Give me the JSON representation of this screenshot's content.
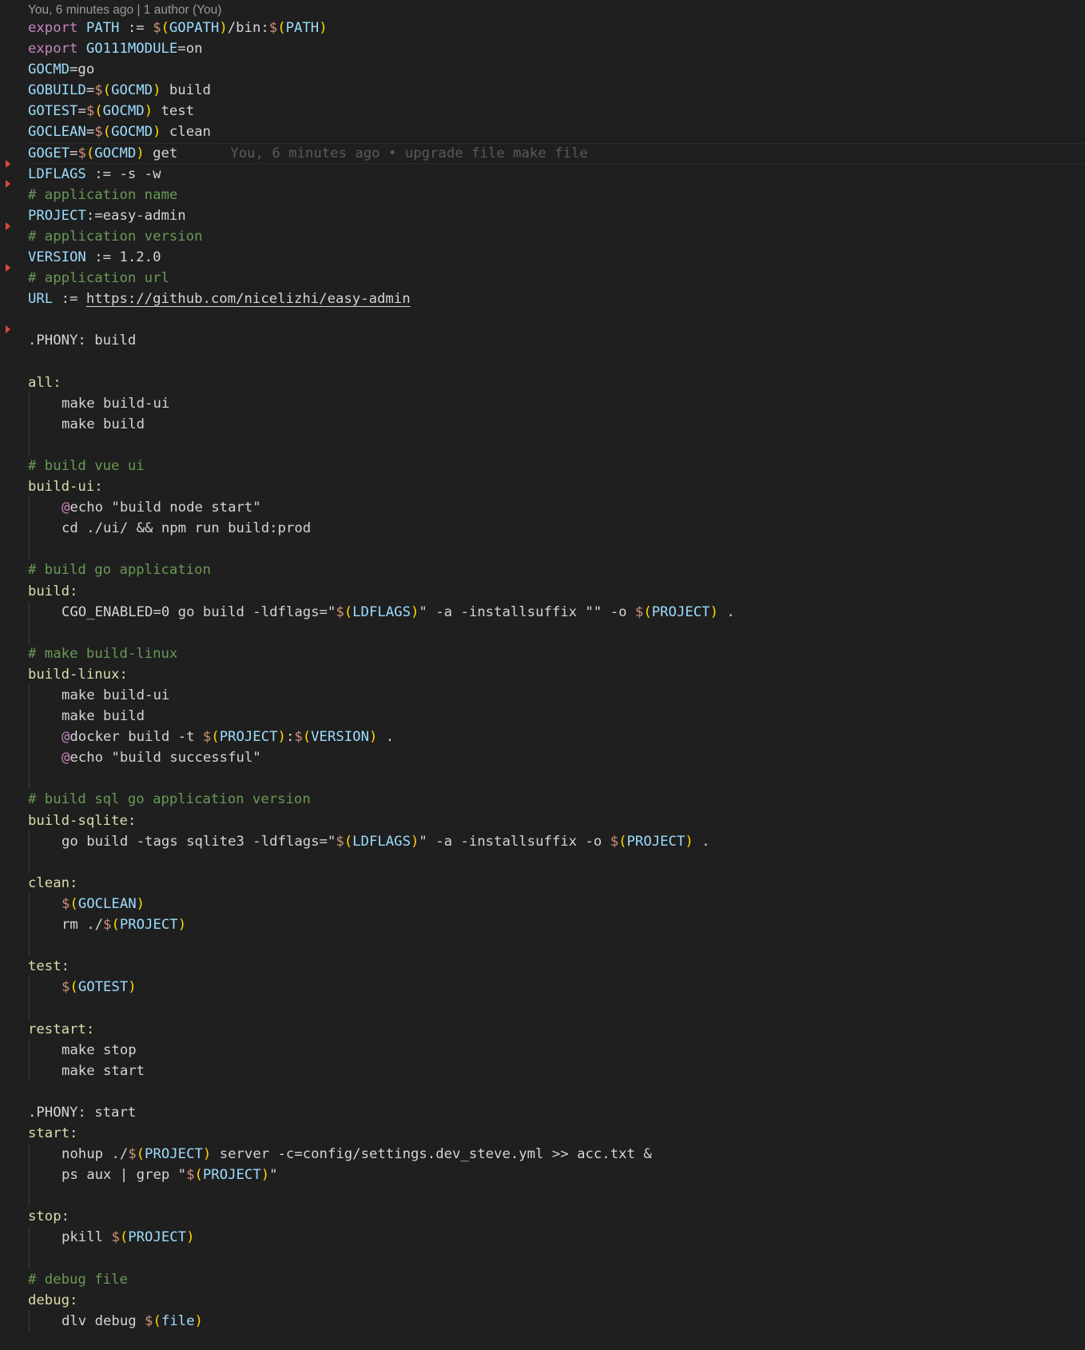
{
  "colors": {
    "background": "#1f1f1f",
    "keyword": "#c586c0",
    "variable": "#9cdcfe",
    "dollar": "#ce9178",
    "paren": "#ffd700",
    "comment": "#6a9955",
    "target": "#dcdcaa"
  },
  "header": {
    "blame": "You, 6 minutes ago | 1 author (You)"
  },
  "inline_blame": "You, 6 minutes ago • upgrade file make file",
  "lines": [
    {
      "t": [
        [
          "export",
          "k"
        ],
        [
          " "
        ],
        [
          "PATH",
          "v"
        ],
        [
          " := "
        ],
        [
          "$",
          "d"
        ],
        [
          "(",
          "p"
        ],
        [
          "GOPATH",
          "v"
        ],
        [
          ")",
          "p"
        ],
        [
          "/bin:"
        ],
        [
          "$",
          "d"
        ],
        [
          "(",
          "p"
        ],
        [
          "PATH",
          "v"
        ],
        [
          ")",
          "p"
        ]
      ]
    },
    {
      "t": [
        [
          "export",
          "k"
        ],
        [
          " "
        ],
        [
          "GO111MODULE",
          "v"
        ],
        [
          "=on"
        ]
      ]
    },
    {
      "t": [
        [
          "GOCMD",
          "v"
        ],
        [
          "=go"
        ]
      ]
    },
    {
      "t": [
        [
          "GOBUILD",
          "v"
        ],
        [
          "="
        ],
        [
          "$",
          "d"
        ],
        [
          "(",
          "p"
        ],
        [
          "GOCMD",
          "v"
        ],
        [
          ")",
          "p"
        ],
        [
          " build"
        ]
      ]
    },
    {
      "t": [
        [
          "GOTEST",
          "v"
        ],
        [
          "="
        ],
        [
          "$",
          "d"
        ],
        [
          "(",
          "p"
        ],
        [
          "GOCMD",
          "v"
        ],
        [
          ")",
          "p"
        ],
        [
          " test"
        ]
      ]
    },
    {
      "t": [
        [
          "GOCLEAN",
          "v"
        ],
        [
          "="
        ],
        [
          "$",
          "d"
        ],
        [
          "(",
          "p"
        ],
        [
          "GOCMD",
          "v"
        ],
        [
          ")",
          "p"
        ],
        [
          " clean"
        ]
      ]
    },
    {
      "cur": true,
      "t": [
        [
          "GOGET",
          "v"
        ],
        [
          "="
        ],
        [
          "$",
          "d"
        ],
        [
          "(",
          "p"
        ],
        [
          "GOCMD",
          "v"
        ],
        [
          ")",
          "p"
        ],
        [
          " get"
        ]
      ]
    },
    {
      "t": [
        [
          "LDFLAGS",
          "v"
        ],
        [
          " := -s -w"
        ]
      ]
    },
    {
      "t": [
        [
          "# application name",
          "c"
        ]
      ]
    },
    {
      "t": [
        [
          "PROJECT",
          "v"
        ],
        [
          ":=easy-admin"
        ]
      ]
    },
    {
      "t": [
        [
          "# application version",
          "c"
        ]
      ]
    },
    {
      "t": [
        [
          "VERSION",
          "v"
        ],
        [
          " := 1.2.0"
        ]
      ]
    },
    {
      "t": [
        [
          "# application url",
          "c"
        ]
      ]
    },
    {
      "t": [
        [
          "URL",
          "v"
        ],
        [
          " := "
        ],
        [
          "https://github.com/nicelizhi/easy-admin",
          "u"
        ]
      ]
    },
    {
      "t": []
    },
    {
      "t": [
        [
          ".PHONY: build"
        ]
      ]
    },
    {
      "t": []
    },
    {
      "t": [
        [
          "all:",
          "t"
        ]
      ]
    },
    {
      "i": true,
      "t": [
        [
          "make build-ui"
        ]
      ]
    },
    {
      "i": true,
      "t": [
        [
          "make build"
        ]
      ]
    },
    {
      "g": true,
      "t": []
    },
    {
      "t": [
        [
          "# build vue ui",
          "c"
        ]
      ]
    },
    {
      "t": [
        [
          "build-ui:",
          "t"
        ]
      ]
    },
    {
      "i": true,
      "t": [
        [
          "@",
          "k"
        ],
        [
          "echo \"build node start\""
        ]
      ]
    },
    {
      "i": true,
      "t": [
        [
          "cd ./ui/ && npm run build:prod"
        ]
      ]
    },
    {
      "g": true,
      "t": []
    },
    {
      "t": [
        [
          "# build go application",
          "c"
        ]
      ]
    },
    {
      "t": [
        [
          "build:",
          "t"
        ]
      ]
    },
    {
      "i": true,
      "t": [
        [
          "CGO_ENABLED=0 go build -ldflags=\""
        ],
        [
          "$",
          "d"
        ],
        [
          "(",
          "p"
        ],
        [
          "LDFLAGS",
          "v"
        ],
        [
          ")",
          "p"
        ],
        [
          "\" -a -installsuffix \"\" -o "
        ],
        [
          "$",
          "d"
        ],
        [
          "(",
          "p"
        ],
        [
          "PROJECT",
          "v"
        ],
        [
          ")",
          "p"
        ],
        [
          " ."
        ]
      ]
    },
    {
      "g": true,
      "t": []
    },
    {
      "t": [
        [
          "# make build-linux",
          "c"
        ]
      ]
    },
    {
      "t": [
        [
          "build-linux:",
          "t"
        ]
      ]
    },
    {
      "i": true,
      "t": [
        [
          "make build-ui"
        ]
      ]
    },
    {
      "i": true,
      "t": [
        [
          "make build"
        ]
      ]
    },
    {
      "i": true,
      "t": [
        [
          "@",
          "k"
        ],
        [
          "docker build -t "
        ],
        [
          "$",
          "d"
        ],
        [
          "(",
          "p"
        ],
        [
          "PROJECT",
          "v"
        ],
        [
          ")",
          "p"
        ],
        [
          ":"
        ],
        [
          "$",
          "d"
        ],
        [
          "(",
          "p"
        ],
        [
          "VERSION",
          "v"
        ],
        [
          ")",
          "p"
        ],
        [
          " ."
        ]
      ]
    },
    {
      "i": true,
      "t": [
        [
          "@",
          "k"
        ],
        [
          "echo \"build successful\""
        ]
      ]
    },
    {
      "g": true,
      "t": []
    },
    {
      "t": [
        [
          "# build sql go application version",
          "c"
        ]
      ]
    },
    {
      "t": [
        [
          "build-sqlite:",
          "t"
        ]
      ]
    },
    {
      "i": true,
      "t": [
        [
          "go build -tags sqlite3 -ldflags=\""
        ],
        [
          "$",
          "d"
        ],
        [
          "(",
          "p"
        ],
        [
          "LDFLAGS",
          "v"
        ],
        [
          ")",
          "p"
        ],
        [
          "\" -a -installsuffix -o "
        ],
        [
          "$",
          "d"
        ],
        [
          "(",
          "p"
        ],
        [
          "PROJECT",
          "v"
        ],
        [
          ")",
          "p"
        ],
        [
          " ."
        ]
      ]
    },
    {
      "g": true,
      "t": []
    },
    {
      "t": [
        [
          "clean:",
          "t"
        ]
      ]
    },
    {
      "i": true,
      "t": [
        [
          "$",
          "d"
        ],
        [
          "(",
          "p"
        ],
        [
          "GOCLEAN",
          "v"
        ],
        [
          ")",
          "p"
        ]
      ]
    },
    {
      "i": true,
      "t": [
        [
          "rm ./"
        ],
        [
          "$",
          "d"
        ],
        [
          "(",
          "p"
        ],
        [
          "PROJECT",
          "v"
        ],
        [
          ")",
          "p"
        ]
      ]
    },
    {
      "g": true,
      "t": []
    },
    {
      "t": [
        [
          "test:",
          "t"
        ]
      ]
    },
    {
      "i": true,
      "t": [
        [
          "$",
          "d"
        ],
        [
          "(",
          "p"
        ],
        [
          "GOTEST",
          "v"
        ],
        [
          ")",
          "p"
        ]
      ]
    },
    {
      "g": true,
      "t": []
    },
    {
      "t": [
        [
          "restart:",
          "t"
        ]
      ]
    },
    {
      "i": true,
      "t": [
        [
          "make stop"
        ]
      ]
    },
    {
      "i": true,
      "t": [
        [
          "make start"
        ]
      ]
    },
    {
      "t": []
    },
    {
      "t": [
        [
          ".PHONY: start"
        ]
      ]
    },
    {
      "t": [
        [
          "start:",
          "t"
        ]
      ]
    },
    {
      "i": true,
      "t": [
        [
          "nohup ./"
        ],
        [
          "$",
          "d"
        ],
        [
          "(",
          "p"
        ],
        [
          "PROJECT",
          "v"
        ],
        [
          ")",
          "p"
        ],
        [
          " server -c=config/settings.dev_steve.yml >> acc.txt &"
        ]
      ]
    },
    {
      "i": true,
      "t": [
        [
          "ps aux | grep \""
        ],
        [
          "$",
          "d"
        ],
        [
          "(",
          "p"
        ],
        [
          "PROJECT",
          "v"
        ],
        [
          ")",
          "p"
        ],
        [
          "\""
        ]
      ]
    },
    {
      "g": true,
      "t": []
    },
    {
      "t": [
        [
          "stop:",
          "t"
        ]
      ]
    },
    {
      "i": true,
      "t": [
        [
          "pkill "
        ],
        [
          "$",
          "d"
        ],
        [
          "(",
          "p"
        ],
        [
          "PROJECT",
          "v"
        ],
        [
          ")",
          "p"
        ]
      ]
    },
    {
      "g": true,
      "t": []
    },
    {
      "t": [
        [
          "# debug file",
          "c"
        ]
      ]
    },
    {
      "t": [
        [
          "debug:",
          "t"
        ]
      ]
    },
    {
      "i": true,
      "t": [
        [
          "dlv debug "
        ],
        [
          "$",
          "d"
        ],
        [
          "(",
          "p"
        ],
        [
          "file",
          "v"
        ],
        [
          ")",
          "p"
        ]
      ]
    }
  ]
}
